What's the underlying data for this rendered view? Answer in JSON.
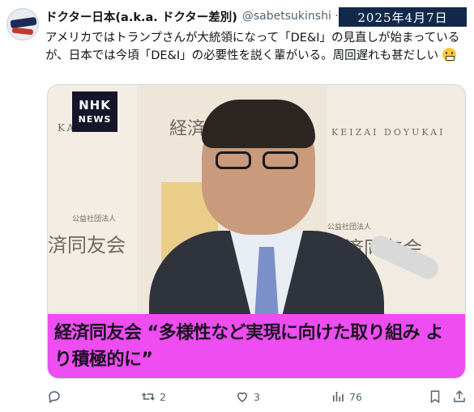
{
  "tweet": {
    "author_name": "ドクター日本(a.k.a. ドクター差別)",
    "handle": "@sabetsukinshi ·",
    "date_overlay": "2025年4月7日",
    "text": "アメリカではトランプさんが大統領になって「DE&I」の見直しが始まっているが、日本では今頃「DE&I」の必要性を説く輩がいる。周回遅れも甚だしい",
    "emoji": "grimacing-face"
  },
  "media": {
    "nhk_logo_line1": "NHK",
    "nhk_logo_line2": "NEWS",
    "bg_text_left": "KAI",
    "bg_text_center": "経済同友会",
    "bg_text_left_bottom": "済同友会",
    "bg_text_small_left": "公益社団法人",
    "bg_text_right_top": "KEIZAI DOYUKAI",
    "bg_text_right": "経済同友会",
    "bg_text_small_right": "公益社団法人",
    "caption": "経済同友会 “多様性など実現に向けた取り組み より積極的に”"
  },
  "actions": {
    "reply_count": "",
    "retweet_count": "2",
    "like_count": "3",
    "views_count": "76"
  },
  "colors": {
    "caption_bg": "#ee4df2",
    "date_badge_bg": "#13294b",
    "text_secondary": "#536471"
  }
}
